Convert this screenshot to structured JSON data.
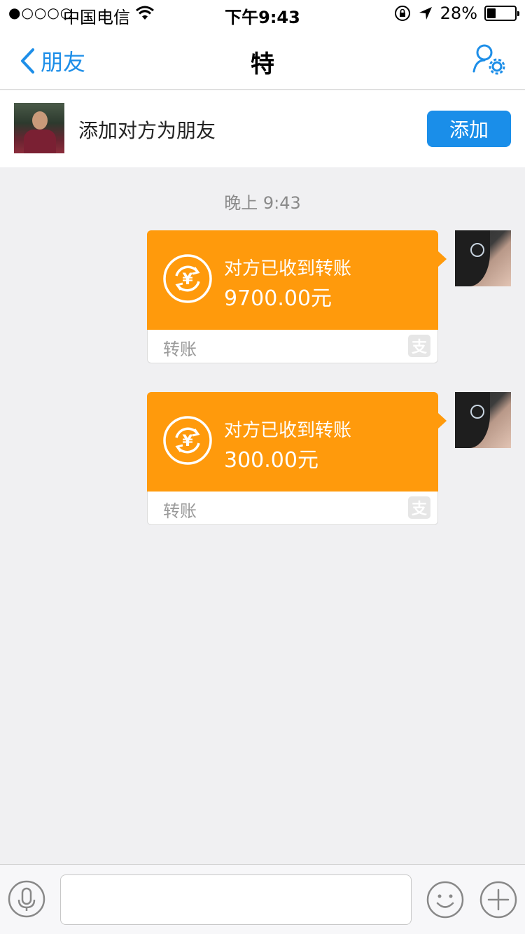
{
  "status_bar": {
    "signal": "●○○○○",
    "carrier": "中国电信",
    "time": "下午9:43",
    "battery_text": "28%",
    "battery_level": 0.28
  },
  "nav": {
    "back_label": "朋友",
    "title": "特"
  },
  "add_friend": {
    "prompt": "添加对方为朋友",
    "button_label": "添加"
  },
  "chat": {
    "timestamp": "晚上 9:43",
    "messages": [
      {
        "title": "对方已收到转账",
        "amount": "9700.00元",
        "label": "转账",
        "badge": "支"
      },
      {
        "title": "对方已收到转账",
        "amount": "300.00元",
        "label": "转账",
        "badge": "支"
      }
    ]
  },
  "input": {
    "placeholder": ""
  },
  "colors": {
    "accent": "#1a8ee9",
    "transfer_orange": "#ff9a0c",
    "background": "#f0f0f2"
  },
  "icons": {
    "wifi": "wifi-icon",
    "back": "chevron-left-icon",
    "settings": "user-settings-icon",
    "transfer": "yuan-transfer-icon",
    "alipay": "alipay-icon",
    "voice": "microphone-icon",
    "emoji": "smiley-icon",
    "plus": "plus-circle-icon"
  }
}
